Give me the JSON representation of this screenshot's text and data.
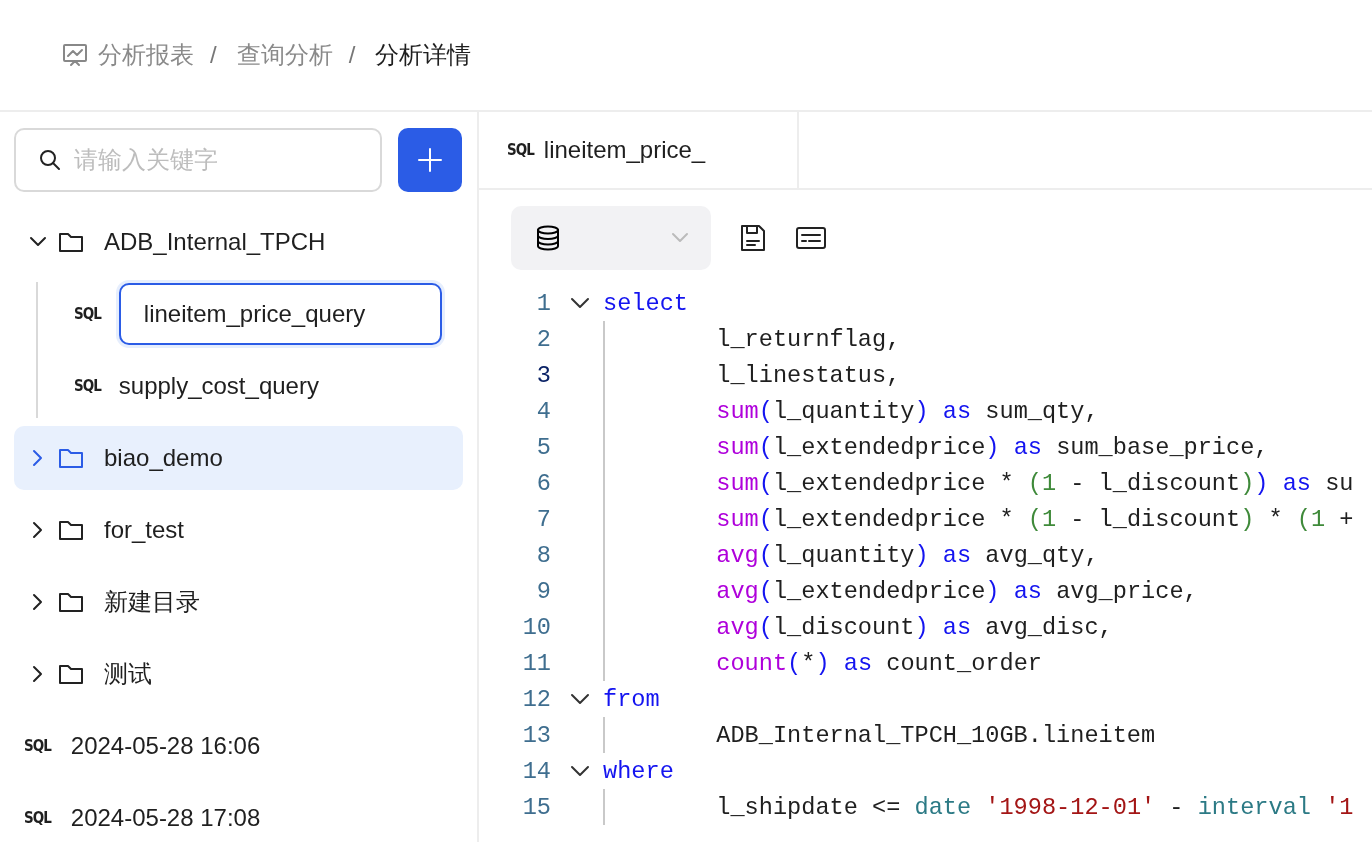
{
  "breadcrumb": [
    {
      "label": "分析报表",
      "current": false,
      "separator": "/"
    },
    {
      "label": "查询分析",
      "current": false,
      "separator": "/"
    },
    {
      "label": "分析详情",
      "current": true
    }
  ],
  "sidebar": {
    "search": {
      "placeholder": "请输入关键字"
    },
    "tree": [
      {
        "kind": "folder",
        "label": "ADB_Internal_TPCH",
        "expanded": true,
        "selected": false,
        "children": [
          {
            "kind": "sql",
            "badge": "SQL",
            "label": "lineitem_price_query",
            "editing": true,
            "selected": false
          },
          {
            "kind": "sql",
            "badge": "SQL",
            "label": "supply_cost_query",
            "editing": false,
            "selected": false
          }
        ]
      },
      {
        "kind": "folder",
        "label": "biao_demo",
        "expanded": false,
        "selected": true
      },
      {
        "kind": "folder",
        "label": "for_test",
        "expanded": false,
        "selected": false
      },
      {
        "kind": "folder",
        "label": "新建目录",
        "expanded": false,
        "selected": false
      },
      {
        "kind": "folder",
        "label": "测试",
        "expanded": false,
        "selected": false
      },
      {
        "kind": "sql",
        "badge": "SQL",
        "label": "2024-05-28 16:06",
        "editing": false,
        "selected": false
      },
      {
        "kind": "sql",
        "badge": "SQL",
        "label": "2024-05-28 17:08",
        "editing": false,
        "selected": false
      }
    ]
  },
  "tabs": [
    {
      "badge": "SQL",
      "label": "lineitem_price_",
      "selected": true
    }
  ],
  "editor": {
    "lines": [
      {
        "number": "1",
        "fold": true,
        "indent": false,
        "current": false,
        "tokens": [
          {
            "kind": "kw",
            "text": "select"
          }
        ]
      },
      {
        "number": "2",
        "fold": false,
        "indent": true,
        "current": false,
        "tokens": [
          {
            "kind": "plain",
            "text": "l_returnflag,"
          }
        ]
      },
      {
        "number": "3",
        "fold": false,
        "indent": true,
        "current": true,
        "tokens": [
          {
            "kind": "plain",
            "text": "l_linestatus,"
          }
        ]
      },
      {
        "number": "4",
        "fold": false,
        "indent": true,
        "current": false,
        "tokens": [
          {
            "kind": "fn",
            "text": "sum"
          },
          {
            "kind": "kw",
            "text": "("
          },
          {
            "kind": "plain",
            "text": "l_quantity"
          },
          {
            "kind": "kw",
            "text": ")"
          },
          {
            "kind": "kw",
            "text": " as"
          },
          {
            "kind": "plain",
            "text": " sum_qty,"
          }
        ]
      },
      {
        "number": "5",
        "fold": false,
        "indent": true,
        "current": false,
        "tokens": [
          {
            "kind": "fn",
            "text": "sum"
          },
          {
            "kind": "kw",
            "text": "("
          },
          {
            "kind": "plain",
            "text": "l_extendedprice"
          },
          {
            "kind": "kw",
            "text": ")"
          },
          {
            "kind": "kw",
            "text": " as"
          },
          {
            "kind": "plain",
            "text": " sum_base_price,"
          }
        ]
      },
      {
        "number": "6",
        "fold": false,
        "indent": true,
        "current": false,
        "tokens": [
          {
            "kind": "fn",
            "text": "sum"
          },
          {
            "kind": "kw",
            "text": "("
          },
          {
            "kind": "plain",
            "text": "l_extendedprice * "
          },
          {
            "kind": "num",
            "text": "(1"
          },
          {
            "kind": "plain",
            "text": " - l_discount"
          },
          {
            "kind": "num",
            "text": ")"
          },
          {
            "kind": "kw",
            "text": ")"
          },
          {
            "kind": "kw",
            "text": " as"
          },
          {
            "kind": "plain",
            "text": " su"
          }
        ]
      },
      {
        "number": "7",
        "fold": false,
        "indent": true,
        "current": false,
        "tokens": [
          {
            "kind": "fn",
            "text": "sum"
          },
          {
            "kind": "kw",
            "text": "("
          },
          {
            "kind": "plain",
            "text": "l_extendedprice * "
          },
          {
            "kind": "num",
            "text": "(1"
          },
          {
            "kind": "plain",
            "text": " - l_discount"
          },
          {
            "kind": "num",
            "text": ")"
          },
          {
            "kind": "plain",
            "text": " * "
          },
          {
            "kind": "num",
            "text": "(1"
          },
          {
            "kind": "plain",
            "text": " +"
          }
        ]
      },
      {
        "number": "8",
        "fold": false,
        "indent": true,
        "current": false,
        "tokens": [
          {
            "kind": "fn",
            "text": "avg"
          },
          {
            "kind": "kw",
            "text": "("
          },
          {
            "kind": "plain",
            "text": "l_quantity"
          },
          {
            "kind": "kw",
            "text": ")"
          },
          {
            "kind": "kw",
            "text": " as"
          },
          {
            "kind": "plain",
            "text": " avg_qty,"
          }
        ]
      },
      {
        "number": "9",
        "fold": false,
        "indent": true,
        "current": false,
        "tokens": [
          {
            "kind": "fn",
            "text": "avg"
          },
          {
            "kind": "kw",
            "text": "("
          },
          {
            "kind": "plain",
            "text": "l_extendedprice"
          },
          {
            "kind": "kw",
            "text": ")"
          },
          {
            "kind": "kw",
            "text": " as"
          },
          {
            "kind": "plain",
            "text": " avg_price,"
          }
        ]
      },
      {
        "number": "10",
        "fold": false,
        "indent": true,
        "current": false,
        "tokens": [
          {
            "kind": "fn",
            "text": "avg"
          },
          {
            "kind": "kw",
            "text": "("
          },
          {
            "kind": "plain",
            "text": "l_discount"
          },
          {
            "kind": "kw",
            "text": ")"
          },
          {
            "kind": "kw",
            "text": " as"
          },
          {
            "kind": "plain",
            "text": " avg_disc,"
          }
        ]
      },
      {
        "number": "11",
        "fold": false,
        "indent": true,
        "current": false,
        "tokens": [
          {
            "kind": "fn",
            "text": "count"
          },
          {
            "kind": "kw",
            "text": "("
          },
          {
            "kind": "plain",
            "text": "*"
          },
          {
            "kind": "kw",
            "text": ")"
          },
          {
            "kind": "kw",
            "text": " as"
          },
          {
            "kind": "plain",
            "text": " count_order"
          }
        ]
      },
      {
        "number": "12",
        "fold": true,
        "indent": false,
        "current": false,
        "tokens": [
          {
            "kind": "kw",
            "text": "from"
          }
        ]
      },
      {
        "number": "13",
        "fold": false,
        "indent": true,
        "current": false,
        "tokens": [
          {
            "kind": "plain",
            "text": "ADB_Internal_TPCH_10GB.lineitem"
          }
        ]
      },
      {
        "number": "14",
        "fold": true,
        "indent": false,
        "current": false,
        "tokens": [
          {
            "kind": "kw",
            "text": "where"
          }
        ]
      },
      {
        "number": "15",
        "fold": false,
        "indent": true,
        "current": false,
        "tokens": [
          {
            "kind": "plain",
            "text": "l_shipdate <= "
          },
          {
            "kind": "type",
            "text": "date"
          },
          {
            "kind": "str",
            "text": " '1998-12-01'"
          },
          {
            "kind": "plain",
            "text": " - "
          },
          {
            "kind": "type",
            "text": "interval"
          },
          {
            "kind": "str",
            "text": " '1"
          }
        ]
      }
    ]
  }
}
